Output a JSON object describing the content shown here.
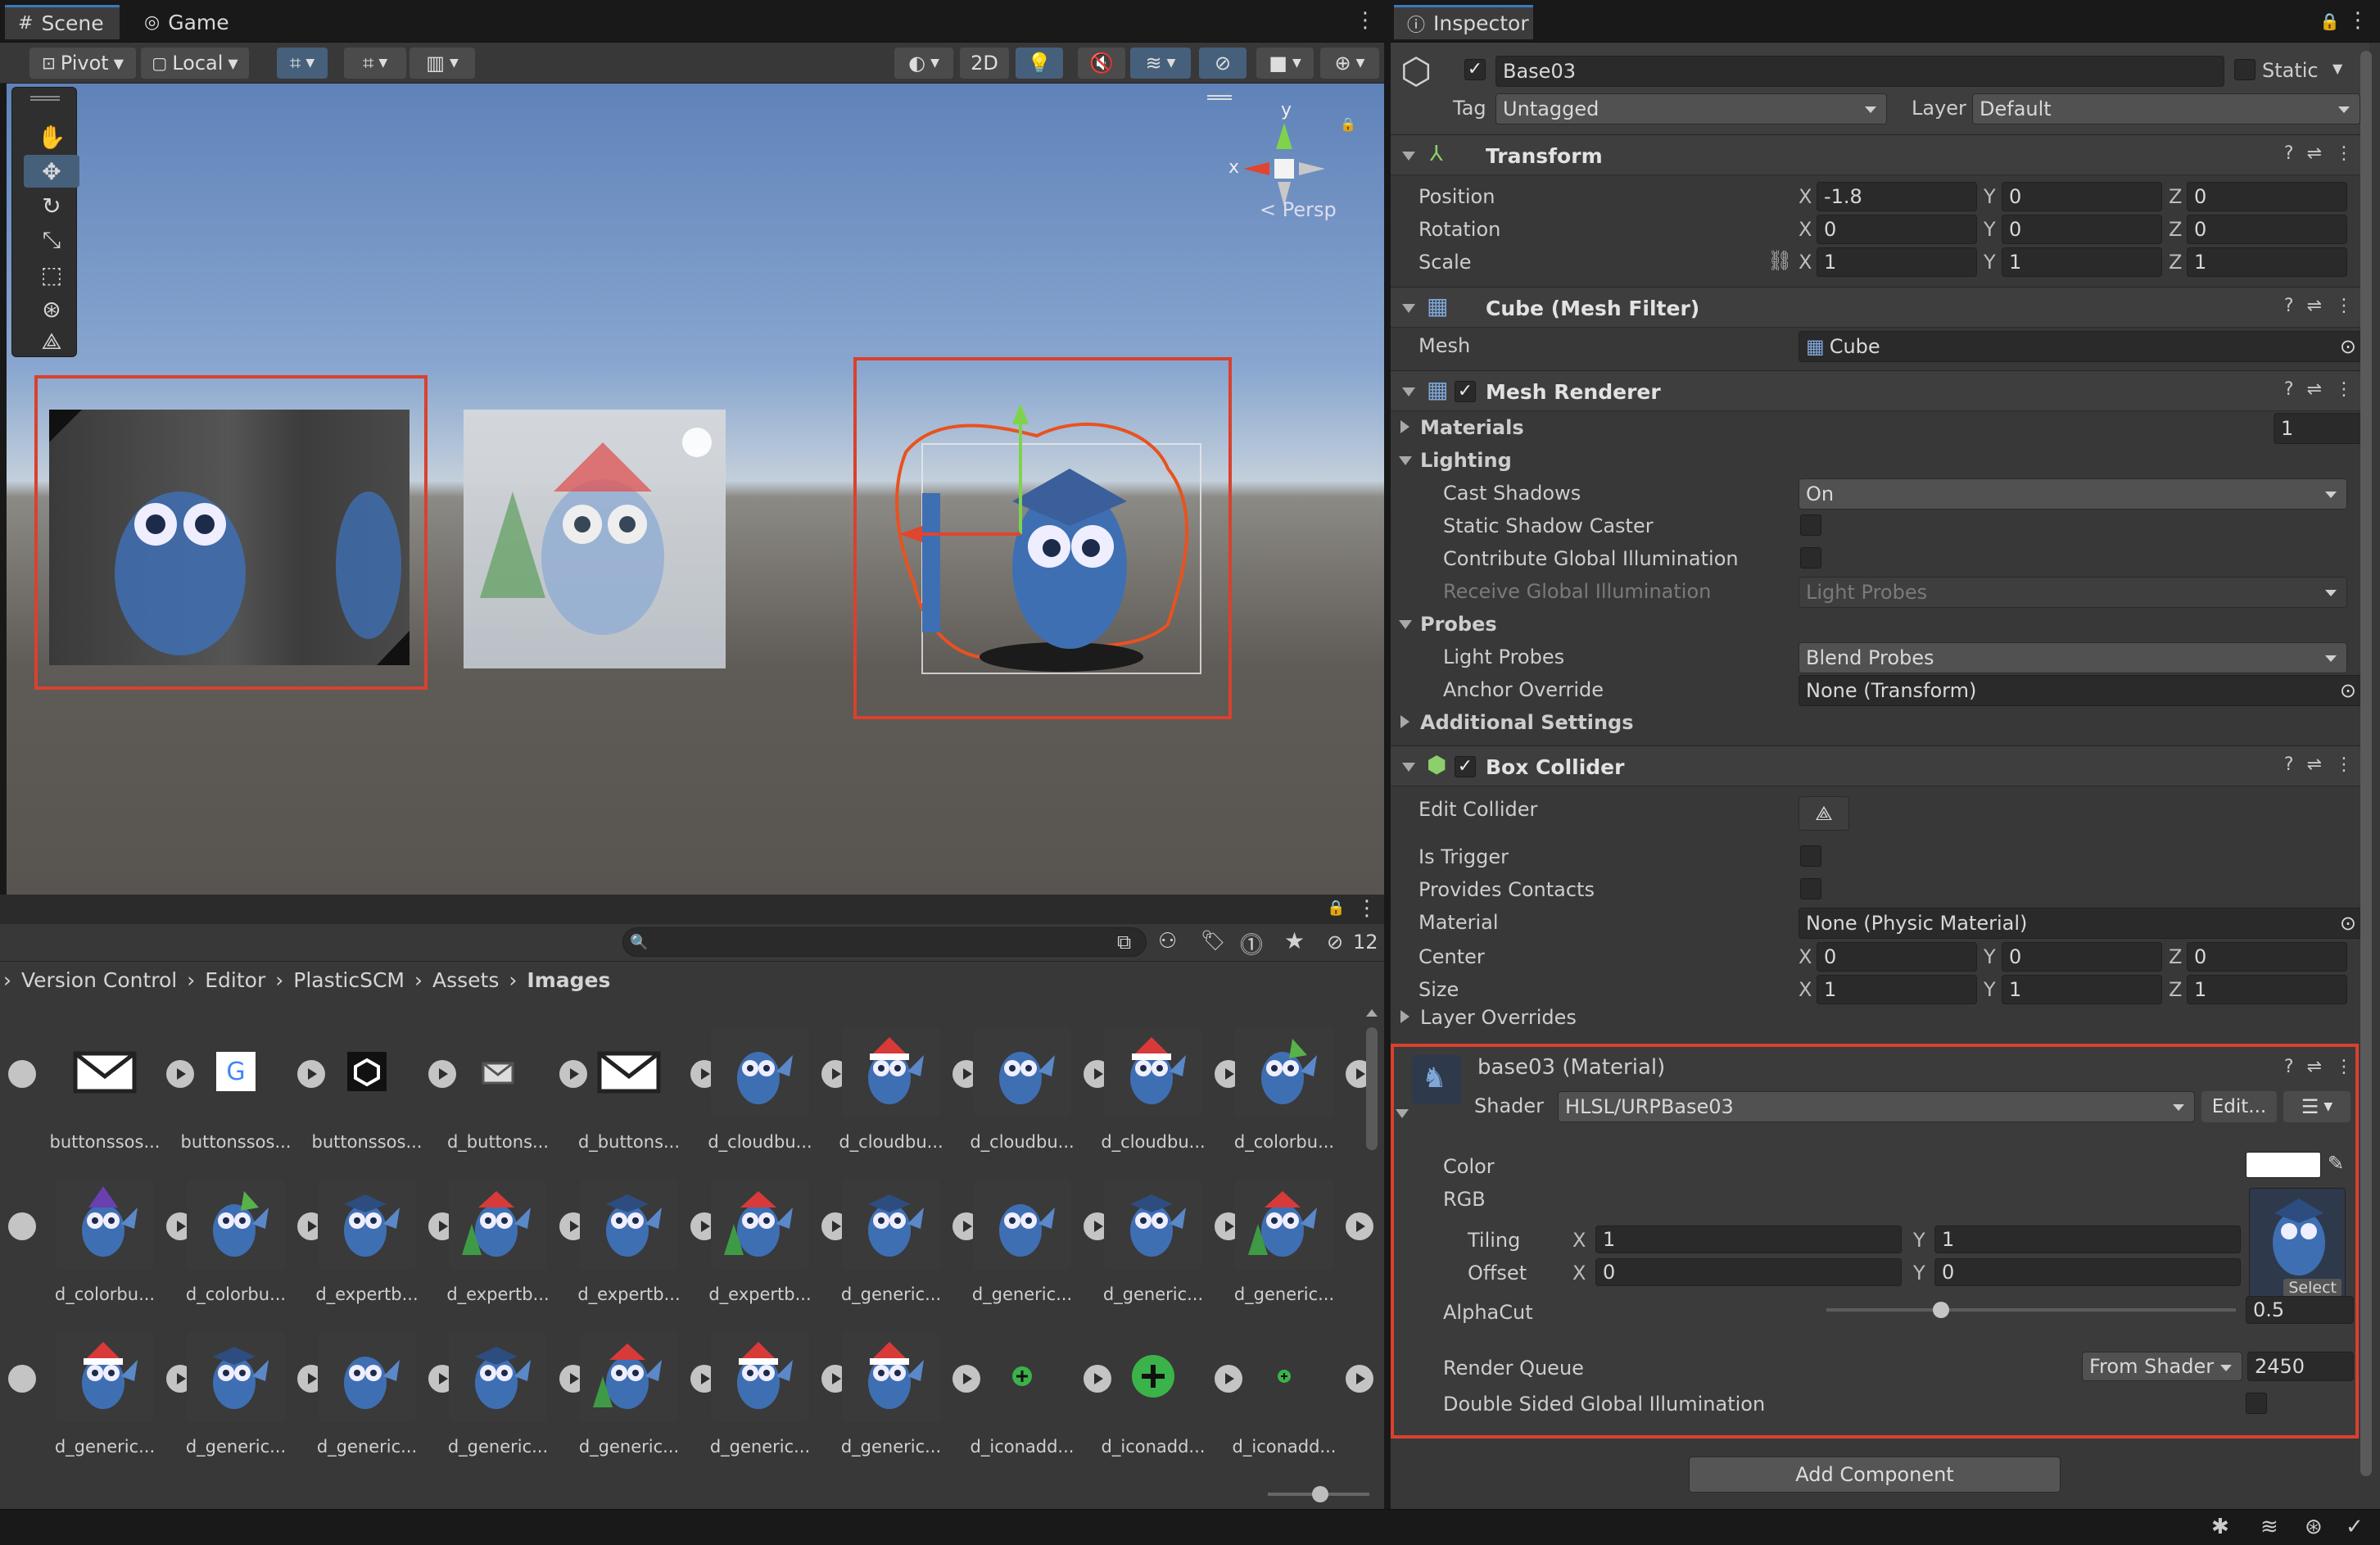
{
  "scene_panel": {
    "tabs": [
      {
        "label": "Scene",
        "icon": "grid-icon"
      },
      {
        "label": "Game",
        "icon": "gamepad-icon"
      }
    ],
    "toolbar": {
      "pivot": "Pivot",
      "local": "Local",
      "mode_2d": "2D"
    },
    "gizmo": {
      "x": "x",
      "y": "y",
      "persp": "Persp"
    }
  },
  "project_panel": {
    "search_placeholder": "",
    "hidden_count": "12",
    "breadcrumb": [
      "Version Control",
      "Editor",
      "PlasticSCM",
      "Assets",
      "Images"
    ],
    "rows": [
      [
        {
          "name": "buttonssos...",
          "kind": "envelope"
        },
        {
          "name": "buttonssos...",
          "kind": "google"
        },
        {
          "name": "buttonssos...",
          "kind": "unity"
        },
        {
          "name": "d_buttons...",
          "kind": "envelope-small"
        },
        {
          "name": "d_buttons...",
          "kind": "envelope"
        },
        {
          "name": "d_cloudbu...",
          "kind": "owl"
        },
        {
          "name": "d_cloudbu...",
          "kind": "owl-santa"
        },
        {
          "name": "d_cloudbu...",
          "kind": "owl"
        },
        {
          "name": "d_cloudbu...",
          "kind": "owl-santa"
        },
        {
          "name": "d_colorbu...",
          "kind": "owl-party"
        }
      ],
      [
        {
          "name": "d_colorbu...",
          "kind": "owl-wizard"
        },
        {
          "name": "d_colorbu...",
          "kind": "owl-party"
        },
        {
          "name": "d_expertb...",
          "kind": "owl-grad"
        },
        {
          "name": "d_expertb...",
          "kind": "owl-tree"
        },
        {
          "name": "d_expertb...",
          "kind": "owl-grad"
        },
        {
          "name": "d_expertb...",
          "kind": "owl-tree"
        },
        {
          "name": "d_generic...",
          "kind": "owl-grad"
        },
        {
          "name": "d_generic...",
          "kind": "owl"
        },
        {
          "name": "d_generic...",
          "kind": "owl-grad"
        },
        {
          "name": "d_generic...",
          "kind": "owl-tree"
        }
      ],
      [
        {
          "name": "d_generic...",
          "kind": "owl-santa"
        },
        {
          "name": "d_generic...",
          "kind": "owl-grad"
        },
        {
          "name": "d_generic...",
          "kind": "owl"
        },
        {
          "name": "d_generic...",
          "kind": "owl-grad"
        },
        {
          "name": "d_generic...",
          "kind": "owl-tree"
        },
        {
          "name": "d_generic...",
          "kind": "owl-santa"
        },
        {
          "name": "d_generic...",
          "kind": "owl-santa"
        },
        {
          "name": "d_iconadd...",
          "kind": "plus-small"
        },
        {
          "name": "d_iconadd...",
          "kind": "plus-large"
        },
        {
          "name": "d_iconadd...",
          "kind": "plus-tiny"
        }
      ]
    ]
  },
  "inspector": {
    "tab": "Inspector",
    "object": {
      "name": "Base03",
      "static_label": "Static",
      "tag_label": "Tag",
      "tag_value": "Untagged",
      "layer_label": "Layer",
      "layer_value": "Default"
    },
    "transform": {
      "title": "Transform",
      "position": {
        "label": "Position",
        "x": "-1.8",
        "y": "0",
        "z": "0"
      },
      "rotation": {
        "label": "Rotation",
        "x": "0",
        "y": "0",
        "z": "0"
      },
      "scale": {
        "label": "Scale",
        "x": "1",
        "y": "1",
        "z": "1"
      }
    },
    "mesh_filter": {
      "title": "Cube (Mesh Filter)",
      "mesh_label": "Mesh",
      "mesh_value": "Cube"
    },
    "mesh_renderer": {
      "title": "Mesh Renderer",
      "materials_label": "Materials",
      "materials_count": "1",
      "lighting_label": "Lighting",
      "cast_shadows_label": "Cast Shadows",
      "cast_shadows_value": "On",
      "static_shadow_label": "Static Shadow Caster",
      "contribute_gi_label": "Contribute Global Illumination",
      "receive_gi_label": "Receive Global Illumination",
      "receive_gi_value": "Light Probes",
      "probes_label": "Probes",
      "light_probes_label": "Light Probes",
      "light_probes_value": "Blend Probes",
      "anchor_label": "Anchor Override",
      "anchor_value": "None (Transform)",
      "additional_label": "Additional Settings"
    },
    "box_collider": {
      "title": "Box Collider",
      "edit_label": "Edit Collider",
      "is_trigger_label": "Is Trigger",
      "provides_contacts_label": "Provides Contacts",
      "material_label": "Material",
      "material_value": "None (Physic Material)",
      "center": {
        "label": "Center",
        "x": "0",
        "y": "0",
        "z": "0"
      },
      "size": {
        "label": "Size",
        "x": "1",
        "y": "1",
        "z": "1"
      },
      "layer_overrides_label": "Layer Overrides"
    },
    "material": {
      "title": "base03 (Material)",
      "shader_label": "Shader",
      "shader_value": "HLSL/URPBase03",
      "edit_label": "Edit...",
      "color_label": "Color",
      "rgb_label": "RGB",
      "tiling": {
        "label": "Tiling",
        "x": "1",
        "y": "1"
      },
      "offset": {
        "label": "Offset",
        "x": "0",
        "y": "0"
      },
      "select_label": "Select",
      "alphacut_label": "AlphaCut",
      "alphacut_value": "0.5",
      "alphacut_fraction": 0.27,
      "render_queue_label": "Render Queue",
      "render_queue_mode": "From Shader",
      "render_queue_value": "2450",
      "double_sided_label": "Double Sided Global Illumination"
    },
    "add_component": "Add Component",
    "axis_labels": {
      "x": "X",
      "y": "Y",
      "z": "Z"
    }
  },
  "colors": {
    "highlight": "#d9412e",
    "accent": "#3a79bb",
    "panel": "#383838",
    "owl": "#3f6fb3"
  }
}
